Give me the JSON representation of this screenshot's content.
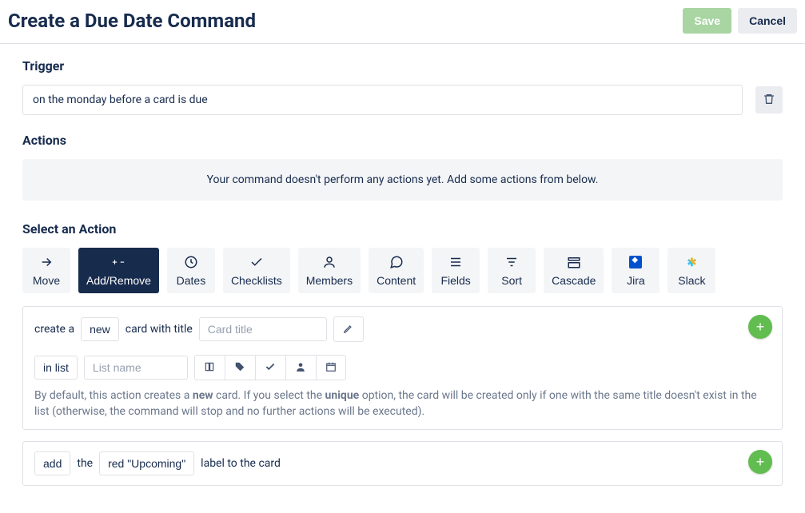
{
  "header": {
    "title": "Create a Due Date Command",
    "save_label": "Save",
    "cancel_label": "Cancel"
  },
  "trigger": {
    "section_label": "Trigger",
    "text": "on the monday before a card is due"
  },
  "actions": {
    "section_label": "Actions",
    "empty_message": "Your command doesn't perform any actions yet. Add some actions from below."
  },
  "select_action": {
    "section_label": "Select an Action",
    "tabs": [
      {
        "label": "Move"
      },
      {
        "label": "Add/Remove"
      },
      {
        "label": "Dates"
      },
      {
        "label": "Checklists"
      },
      {
        "label": "Members"
      },
      {
        "label": "Content"
      },
      {
        "label": "Fields"
      },
      {
        "label": "Sort"
      },
      {
        "label": "Cascade"
      },
      {
        "label": "Jira"
      },
      {
        "label": "Slack"
      }
    ]
  },
  "card1": {
    "t_create_a": "create a",
    "chip_new": "new",
    "t_card_with_title": "card with title",
    "placeholder_title": "Card title",
    "t_in_list": "in list",
    "placeholder_list": "List name",
    "help_pre": "By default, this action creates a ",
    "help_bold1": "new",
    "help_mid": " card. If you select the ",
    "help_bold2": "unique",
    "help_post": " option, the card will be created only if one with the same title doesn't exist in the list (otherwise, the command will stop and no further actions will be executed)."
  },
  "card2": {
    "chip_add": "add",
    "t_the": "the",
    "chip_label": "red \"Upcoming\"",
    "t_label_to_card": "label to the card"
  }
}
